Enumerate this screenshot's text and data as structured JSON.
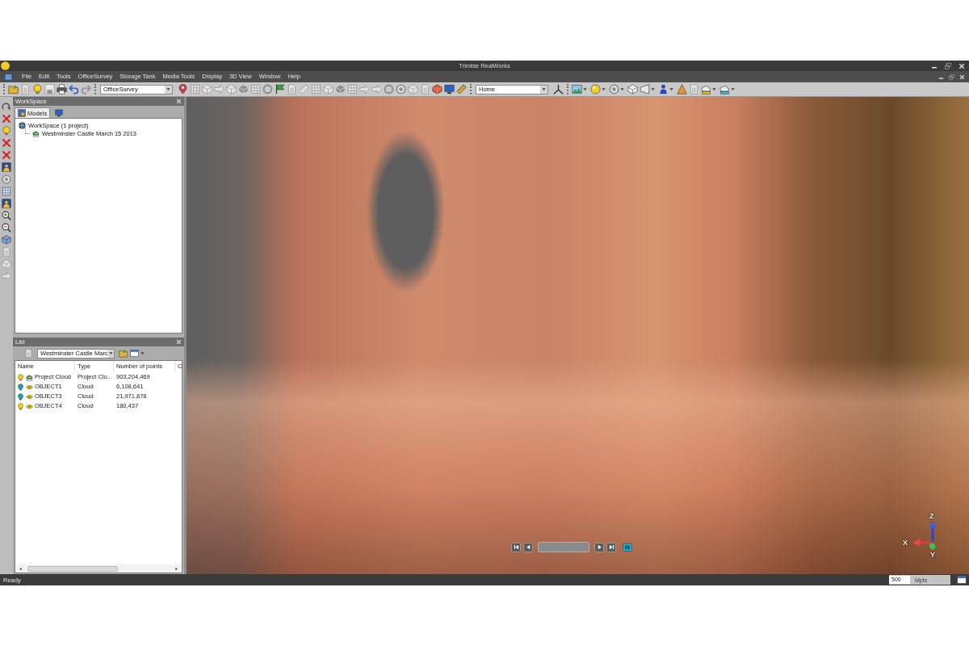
{
  "window": {
    "title": "Trimble RealWorks"
  },
  "menu": [
    "File",
    "Edit",
    "Tools",
    "OfficeSurvey",
    "Storage Tank",
    "Media Tools",
    "Display",
    "3D View",
    "Window",
    "Help"
  ],
  "toolbar": {
    "group_1": [
      {
        "kind": "folder",
        "disabled": false
      },
      {
        "kind": "page",
        "disabled": true
      },
      {
        "kind": "bulb",
        "disabled": false
      },
      {
        "kind": "floppy",
        "disabled": true
      },
      {
        "kind": "printer",
        "disabled": false
      },
      {
        "kind": "undo",
        "disabled": false
      },
      {
        "kind": "redo",
        "disabled": true
      }
    ],
    "workflow": "OfficeSurvey",
    "group_2": [
      {
        "kind": "pin",
        "disabled": false
      },
      {
        "kind": "grid",
        "disabled": true
      },
      {
        "kind": "cube",
        "disabled": true
      },
      {
        "kind": "arrow",
        "disabled": true
      },
      {
        "kind": "cube",
        "disabled": true
      },
      {
        "kind": "box",
        "disabled": true
      },
      {
        "kind": "grid",
        "disabled": true
      },
      {
        "kind": "ring",
        "disabled": true
      },
      {
        "kind": "flag",
        "disabled": false
      },
      {
        "kind": "page",
        "disabled": true
      },
      {
        "kind": "ruler",
        "disabled": true
      },
      {
        "kind": "grid",
        "disabled": true
      },
      {
        "kind": "cube",
        "disabled": true
      },
      {
        "kind": "box",
        "disabled": true
      },
      {
        "kind": "grid",
        "disabled": true
      },
      {
        "kind": "arrow",
        "disabled": true
      },
      {
        "kind": "arrow",
        "disabled": true
      },
      {
        "kind": "ring",
        "disabled": true
      },
      {
        "kind": "gear",
        "disabled": true
      },
      {
        "kind": "cube",
        "disabled": true
      },
      {
        "kind": "page",
        "disabled": true
      },
      {
        "kind": "crate",
        "disabled": false
      },
      {
        "kind": "monitor",
        "disabled": false
      },
      {
        "kind": "ruler",
        "disabled": false
      }
    ],
    "view": "Home",
    "group_3": [
      {
        "kind": "axes",
        "disabled": false,
        "dropdown": false
      },
      {
        "kind": "landscape",
        "disabled": false,
        "dropdown": true
      },
      {
        "kind": "sphere",
        "disabled": false,
        "dropdown": true
      },
      {
        "kind": "gear",
        "disabled": true,
        "dropdown": true
      },
      {
        "kind": "box",
        "disabled": false,
        "dropdown": false
      },
      {
        "kind": "frustum",
        "disabled": false,
        "dropdown": true
      },
      {
        "kind": "person",
        "disabled": false,
        "dropdown": true
      },
      {
        "kind": "cone",
        "disabled": false,
        "dropdown": false
      },
      {
        "kind": "page",
        "disabled": true,
        "dropdown": false
      },
      {
        "kind": "cloud",
        "disabled": false,
        "dropdown": true
      },
      {
        "kind": "layer",
        "disabled": false,
        "dropdown": true
      }
    ]
  },
  "tools": [
    {
      "kind": "loop",
      "disabled": false
    },
    {
      "kind": "cross",
      "disabled": false
    },
    {
      "kind": "bulb",
      "disabled": false
    },
    {
      "kind": "cross",
      "disabled": false
    },
    {
      "kind": "cross",
      "disabled": false
    },
    {
      "kind": "picture",
      "disabled": false
    },
    {
      "kind": "gear",
      "disabled": true
    },
    {
      "kind": "grid",
      "disabled": false
    },
    {
      "kind": "picture",
      "disabled": false
    },
    {
      "kind": "zoomin",
      "disabled": false
    },
    {
      "kind": "zoomout",
      "disabled": false
    },
    {
      "kind": "cube",
      "disabled": false
    },
    {
      "kind": "page",
      "disabled": true
    },
    {
      "kind": "cube",
      "disabled": true
    },
    {
      "kind": "arrow",
      "disabled": true
    }
  ],
  "workspace": {
    "title": "WorkSpace",
    "tabs": [
      {
        "label": "Models",
        "selected": true
      },
      {
        "selected": false
      }
    ],
    "tree": [
      {
        "label": "WorkSpace (1 project)",
        "children": [
          {
            "label": "Westminster Castle March 15 2013"
          }
        ]
      }
    ]
  },
  "list": {
    "title": "List",
    "tools_before": [
      {
        "kind": "page",
        "disabled": true
      }
    ],
    "selector": "Westminster Castle Marc",
    "tools_after": [
      {
        "kind": "folder",
        "disabled": false,
        "dropdown": false
      },
      {
        "kind": "window",
        "disabled": false,
        "dropdown": true
      }
    ],
    "columns": [
      "Name",
      "Type",
      "Number of points",
      "C"
    ],
    "rows": [
      {
        "name": "Project Cloud",
        "type": "Project Clo...",
        "points": "903,204,469",
        "kind": "project",
        "visible": true
      },
      {
        "name": "OBJECT1",
        "type": "Cloud",
        "points": "6,108,641",
        "kind": "cloud",
        "visible": false
      },
      {
        "name": "OBJECT3",
        "type": "Cloud",
        "points": "21,971,878",
        "kind": "cloud",
        "visible": false
      },
      {
        "name": "OBJECT4",
        "type": "Cloud",
        "points": "180,437",
        "kind": "cloud",
        "visible": true
      }
    ]
  },
  "viewer": {
    "axis_labels": {
      "z": "Z",
      "x": "X",
      "y": "Y"
    }
  },
  "status_bar": {
    "text": "Ready",
    "point_budget": "500",
    "unit": "Mpts"
  }
}
